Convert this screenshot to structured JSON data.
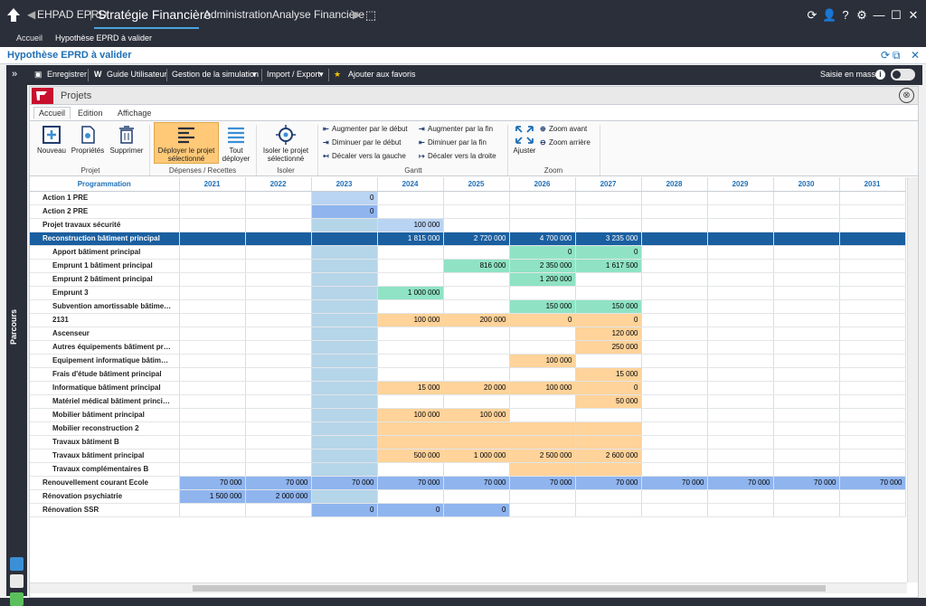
{
  "titlebar": {
    "app": "EHPAD EPRD",
    "nav": [
      "Stratégie Financière",
      "Administration",
      "Analyse Financière"
    ]
  },
  "tabs": [
    "Accueil",
    "Hypothèse EPRD à valider"
  ],
  "page_title": "Hypothèse EPRD à valider",
  "toolbar": {
    "items": [
      "Enregistrer",
      "Guide Utilisateur",
      "Gestion de la simulation",
      "Import / Export",
      "Ajouter aux favoris"
    ],
    "mass_entry": "Saisie en masse"
  },
  "rail_label": "Parcours",
  "panel_title": "Projets",
  "ribbon": {
    "tabs": [
      "Accueil",
      "Edition",
      "Affichage"
    ],
    "buttons": {
      "nouveau": "Nouveau",
      "proprietes": "Propriétés",
      "supprimer": "Supprimer",
      "deployer_sel": "Déployer le projet sélectionné",
      "tout_deployer": "Tout déployer",
      "isoler": "Isoler le projet sélectionné",
      "ajuster": "Ajuster",
      "zoom_avant": "Zoom avant",
      "zoom_arriere": "Zoom arrière",
      "aug_debut": "Augmenter par le début",
      "dim_debut": "Diminuer par le début",
      "dec_gauche": "Décaler vers la gauche",
      "aug_fin": "Augmenter par la fin",
      "dim_fin": "Diminuer par la fin",
      "dec_droite": "Décaler vers la droite"
    },
    "groups": [
      "Projet",
      "Dépenses / Recettes",
      "Isoler",
      "Gantt",
      "Zoom"
    ]
  },
  "grid": {
    "header": "Programmation",
    "years": [
      "2021",
      "2022",
      "2023",
      "2024",
      "2025",
      "2026",
      "2027",
      "2028",
      "2029",
      "2030",
      "2031"
    ],
    "rows": [
      {
        "name": "Action 1 PRE",
        "child": false,
        "cells": [
          "",
          "",
          "0",
          "",
          "",
          "",
          "",
          "",
          "",
          "",
          ""
        ],
        "colors": [
          "",
          "",
          "lblue",
          "",
          "",
          "",
          "",
          "",
          "",
          "",
          ""
        ]
      },
      {
        "name": "Action 2 PRE",
        "child": false,
        "cells": [
          "",
          "",
          "0",
          "",
          "",
          "",
          "",
          "",
          "",
          "",
          ""
        ],
        "colors": [
          "",
          "",
          "blue",
          "",
          "",
          "",
          "",
          "",
          "",
          "",
          ""
        ]
      },
      {
        "name": "Projet travaux sécurité",
        "child": false,
        "cells": [
          "",
          "",
          "",
          "100 000",
          "",
          "",
          "",
          "",
          "",
          "",
          ""
        ],
        "colors": [
          "",
          "",
          "",
          "lblue",
          "",
          "",
          "",
          "",
          "",
          "",
          ""
        ]
      },
      {
        "name": "Reconstruction bâtiment principal",
        "child": false,
        "selected": true,
        "cells": [
          "",
          "",
          "",
          "1 815 000",
          "2 720 000",
          "4 700 000",
          "3 235 000",
          "",
          "",
          "",
          ""
        ],
        "colors": [
          "",
          "",
          "",
          "",
          "",
          "",
          "",
          "",
          "",
          "",
          ""
        ]
      },
      {
        "name": "Apport bâtiment principal",
        "child": true,
        "cells": [
          "",
          "",
          "",
          "",
          "",
          "0",
          "0",
          "",
          "",
          "",
          ""
        ],
        "colors": [
          "",
          "",
          "",
          "",
          "",
          "green",
          "green",
          "",
          "",
          "",
          ""
        ]
      },
      {
        "name": "Emprunt 1 bâtiment principal",
        "child": true,
        "cells": [
          "",
          "",
          "",
          "",
          "816 000",
          "2 350 000",
          "1 617 500",
          "",
          "",
          "",
          ""
        ],
        "colors": [
          "",
          "",
          "",
          "",
          "green",
          "green",
          "green",
          "",
          "",
          "",
          ""
        ]
      },
      {
        "name": "Emprunt 2 bâtiment principal",
        "child": true,
        "cells": [
          "",
          "",
          "",
          "",
          "",
          "1 200 000",
          "",
          "",
          "",
          "",
          ""
        ],
        "colors": [
          "",
          "",
          "",
          "",
          "",
          "green",
          "",
          "",
          "",
          "",
          ""
        ]
      },
      {
        "name": "Emprunt 3",
        "child": true,
        "cells": [
          "",
          "",
          "",
          "1 000 000",
          "",
          "",
          "",
          "",
          "",
          "",
          ""
        ],
        "colors": [
          "",
          "",
          "",
          "green",
          "",
          "",
          "",
          "",
          "",
          "",
          ""
        ]
      },
      {
        "name": "Subvention amortissable bâtime…",
        "child": true,
        "cells": [
          "",
          "",
          "",
          "",
          "",
          "150 000",
          "150 000",
          "",
          "",
          "",
          ""
        ],
        "colors": [
          "",
          "",
          "",
          "",
          "",
          "green",
          "green",
          "",
          "",
          "",
          ""
        ]
      },
      {
        "name": "2131",
        "child": true,
        "cells": [
          "",
          "",
          "",
          "100 000",
          "200 000",
          "0",
          "0",
          "",
          "",
          "",
          ""
        ],
        "colors": [
          "",
          "",
          "",
          "orange",
          "orange",
          "orange",
          "orange",
          "",
          "",
          "",
          ""
        ]
      },
      {
        "name": "Ascenseur",
        "child": true,
        "cells": [
          "",
          "",
          "",
          "",
          "",
          "",
          "120 000",
          "",
          "",
          "",
          ""
        ],
        "colors": [
          "",
          "",
          "",
          "",
          "",
          "",
          "orange",
          "",
          "",
          "",
          ""
        ]
      },
      {
        "name": "Autres équipements bâtiment pr…",
        "child": true,
        "cells": [
          "",
          "",
          "",
          "",
          "",
          "",
          "250 000",
          "",
          "",
          "",
          ""
        ],
        "colors": [
          "",
          "",
          "",
          "",
          "",
          "",
          "orange",
          "",
          "",
          "",
          ""
        ]
      },
      {
        "name": "Equipement informatique bâtim…",
        "child": true,
        "cells": [
          "",
          "",
          "",
          "",
          "",
          "100 000",
          "",
          "",
          "",
          "",
          ""
        ],
        "colors": [
          "",
          "",
          "",
          "",
          "",
          "orange",
          "",
          "",
          "",
          "",
          ""
        ]
      },
      {
        "name": "Frais d'étude bâtiment principal",
        "child": true,
        "cells": [
          "",
          "",
          "",
          "",
          "",
          "",
          "15 000",
          "",
          "",
          "",
          ""
        ],
        "colors": [
          "",
          "",
          "",
          "",
          "",
          "",
          "orange",
          "",
          "",
          "",
          ""
        ]
      },
      {
        "name": "Informatique bâtiment principal",
        "child": true,
        "cells": [
          "",
          "",
          "",
          "15 000",
          "20 000",
          "100 000",
          "0",
          "",
          "",
          "",
          ""
        ],
        "colors": [
          "",
          "",
          "",
          "orange",
          "orange",
          "orange",
          "orange",
          "",
          "",
          "",
          ""
        ]
      },
      {
        "name": "Matériel médical bâtiment princi…",
        "child": true,
        "cells": [
          "",
          "",
          "",
          "",
          "",
          "",
          "50 000",
          "",
          "",
          "",
          ""
        ],
        "colors": [
          "",
          "",
          "",
          "",
          "",
          "",
          "orange",
          "",
          "",
          "",
          ""
        ]
      },
      {
        "name": "Mobilier bâtiment principal",
        "child": true,
        "cells": [
          "",
          "",
          "",
          "100 000",
          "100 000",
          "",
          "",
          "",
          "",
          "",
          ""
        ],
        "colors": [
          "",
          "",
          "",
          "orange",
          "orange",
          "",
          "",
          "",
          "",
          "",
          ""
        ]
      },
      {
        "name": "Mobilier reconstruction 2",
        "child": true,
        "cells": [
          "",
          "",
          "",
          "",
          "",
          "",
          "",
          "",
          "",
          "",
          ""
        ],
        "colors": [
          "",
          "",
          "",
          "orange",
          "orange",
          "orange",
          "orange",
          "",
          "",
          "",
          ""
        ]
      },
      {
        "name": "Travaux bâtiment B",
        "child": true,
        "cells": [
          "",
          "",
          "",
          "",
          "",
          "",
          "",
          "",
          "",
          "",
          ""
        ],
        "colors": [
          "",
          "",
          "",
          "orange",
          "orange",
          "orange",
          "orange",
          "",
          "",
          "",
          ""
        ]
      },
      {
        "name": "Travaux bâtiment principal",
        "child": true,
        "cells": [
          "",
          "",
          "",
          "500 000",
          "1 000 000",
          "2 500 000",
          "2 600 000",
          "",
          "",
          "",
          ""
        ],
        "colors": [
          "",
          "",
          "",
          "orange",
          "orange",
          "orange",
          "orange",
          "",
          "",
          "",
          ""
        ]
      },
      {
        "name": "Travaux complémentaires B",
        "child": true,
        "cells": [
          "",
          "",
          "",
          "",
          "",
          "",
          "",
          "",
          "",
          "",
          ""
        ],
        "colors": [
          "",
          "",
          "",
          "",
          "",
          "orange",
          "orange",
          "",
          "",
          "",
          ""
        ]
      },
      {
        "name": "Renouvellement courant Ecole",
        "child": false,
        "cells": [
          "70 000",
          "70 000",
          "70 000",
          "70 000",
          "70 000",
          "70 000",
          "70 000",
          "70 000",
          "70 000",
          "70 000",
          "70 000"
        ],
        "colors": [
          "blue",
          "blue",
          "blue",
          "blue",
          "blue",
          "blue",
          "blue",
          "blue",
          "blue",
          "blue",
          "blue"
        ]
      },
      {
        "name": "Rénovation psychiatrie",
        "child": false,
        "cells": [
          "1 500 000",
          "2 000 000",
          "",
          "",
          "",
          "",
          "",
          "",
          "",
          "",
          ""
        ],
        "colors": [
          "blue",
          "blue",
          "",
          "",
          "",
          "",
          "",
          "",
          "",
          "",
          ""
        ]
      },
      {
        "name": "Rénovation SSR",
        "child": false,
        "cells": [
          "",
          "",
          "0",
          "0",
          "0",
          "",
          "",
          "",
          "",
          "",
          ""
        ],
        "colors": [
          "",
          "",
          "blue",
          "blue",
          "blue",
          "",
          "",
          "",
          "",
          "",
          ""
        ]
      }
    ]
  }
}
